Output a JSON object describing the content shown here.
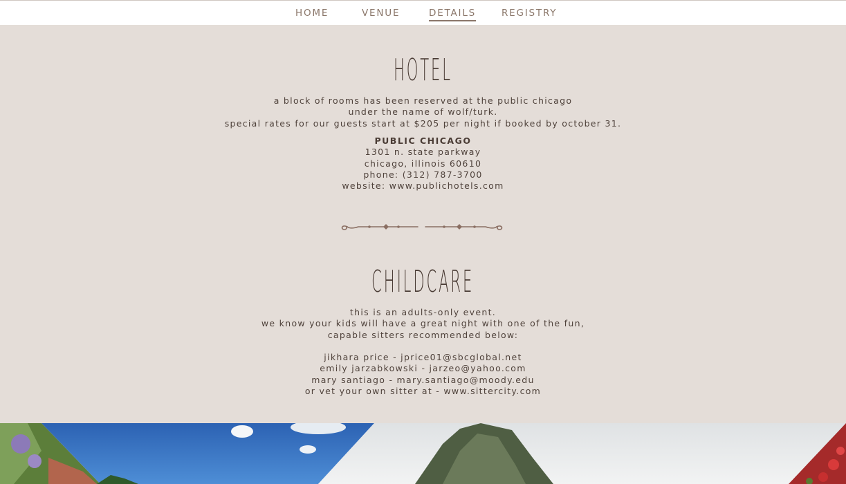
{
  "nav": {
    "items": [
      {
        "label": "HOME",
        "active": false
      },
      {
        "label": "VENUE",
        "active": false
      },
      {
        "label": "DETAILS",
        "active": true
      },
      {
        "label": "REGISTRY",
        "active": false
      }
    ]
  },
  "hotel": {
    "title": "HOTEL",
    "intro": [
      "a block of rooms has been reserved at the public chicago",
      "under the name of wolf/turk.",
      "special rates for our guests start at $205 per night if booked by october 31."
    ],
    "name": "PUBLIC CHICAGO",
    "address_line1": "1301 n. state parkway",
    "address_line2": "chicago, illinois 60610",
    "phone": "phone: (312) 787-3700",
    "website": "website: www.publichotels.com"
  },
  "divider_icon": "ornamental-flourish-icon",
  "childcare": {
    "title": "CHILDCARE",
    "intro": [
      "this is an adults-only event.",
      "we know your kids will have a great night with one of the fun,",
      "capable sitters recommended below:"
    ],
    "sitters": [
      "jikhara price - jprice01@sbcglobal.net",
      "emily jarzabkowski - jarzeo@yahoo.com",
      "mary santiago - mary.santiago@moody.edu",
      "or vet your own sitter at - www.sittercity.com"
    ]
  },
  "colors": {
    "background": "#e4ddd8",
    "nav_text": "#8a7669",
    "body_text": "#4f423b",
    "ornament": "#8a6e62"
  }
}
